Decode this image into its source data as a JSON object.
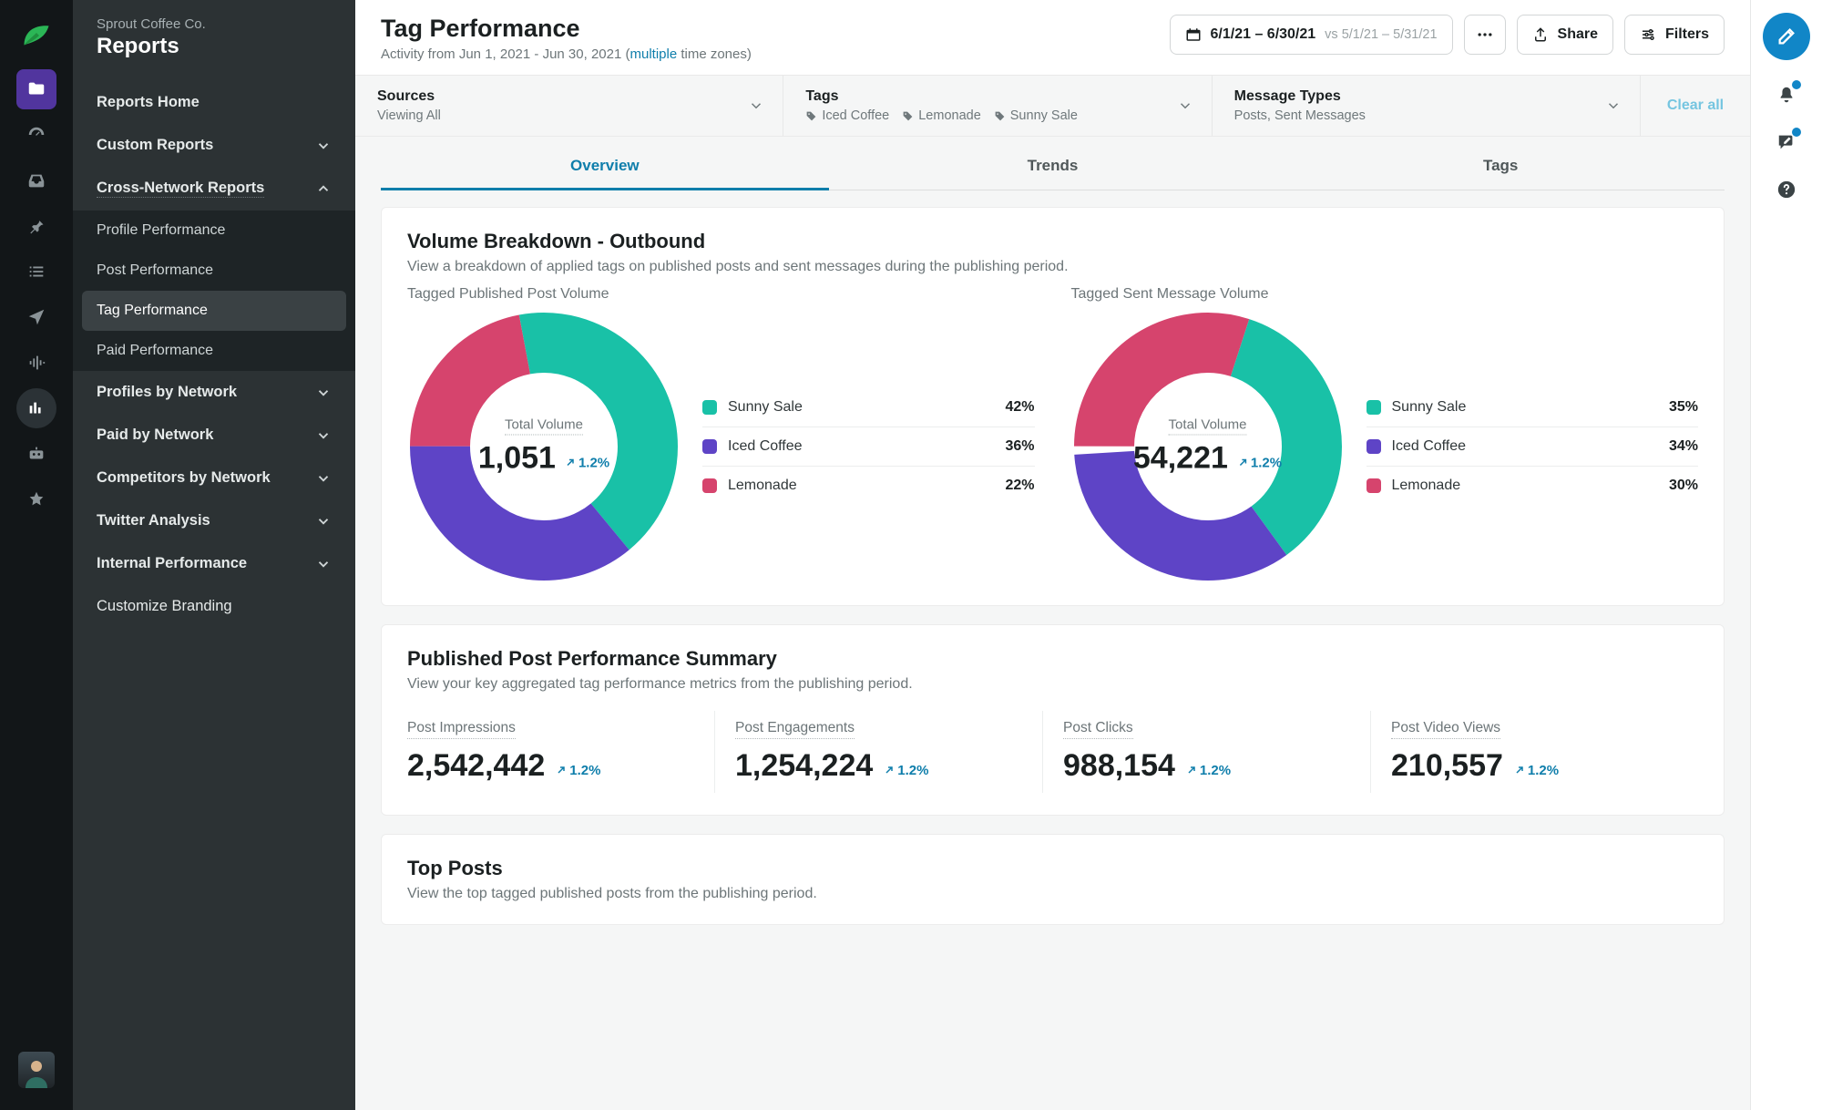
{
  "brand": {
    "company": "Sprout Coffee Co.",
    "section": "Reports"
  },
  "sidebar": {
    "reports_home": "Reports Home",
    "custom_reports": "Custom Reports",
    "cross_network": "Cross-Network Reports",
    "sub": {
      "profile_perf": "Profile Performance",
      "post_perf": "Post Performance",
      "tag_perf": "Tag Performance",
      "paid_perf": "Paid Performance"
    },
    "profiles_by_net": "Profiles by Network",
    "paid_by_net": "Paid by Network",
    "competitors_by_net": "Competitors by Network",
    "twitter_analysis": "Twitter Analysis",
    "internal_perf": "Internal Performance",
    "customize_branding": "Customize Branding"
  },
  "header": {
    "title": "Tag Performance",
    "activity_prefix": "Activity from Jun 1, 2021 - Jun 30, 2021 (",
    "multiple": "multiple",
    "activity_suffix": " time zones)",
    "date_main": "6/1/21 – 6/30/21",
    "date_vs": "vs 5/1/21 – 5/31/21",
    "share": "Share",
    "filters": "Filters"
  },
  "filters": {
    "sources_lbl": "Sources",
    "sources_val": "Viewing All",
    "tags_lbl": "Tags",
    "tag1": "Iced Coffee",
    "tag2": "Lemonade",
    "tag3": "Sunny Sale",
    "types_lbl": "Message Types",
    "types_val": "Posts, Sent Messages",
    "clear": "Clear all"
  },
  "tabs": {
    "overview": "Overview",
    "trends": "Trends",
    "tags": "Tags"
  },
  "volume": {
    "title": "Volume Breakdown - Outbound",
    "sub": "View a breakdown of applied tags on published posts and sent messages during the publishing period.",
    "post_head": "Tagged Published Post Volume",
    "msg_head": "Tagged Sent Message Volume",
    "center_lbl": "Total Volume",
    "post_total": "1,051",
    "msg_total": "54,221",
    "trend": "1.2%",
    "legend": {
      "sunny": "Sunny Sale",
      "iced": "Iced Coffee",
      "lemon": "Lemonade"
    },
    "post_pct": {
      "sunny": "42%",
      "iced": "36%",
      "lemon": "22%"
    },
    "msg_pct": {
      "sunny": "35%",
      "iced": "34%",
      "lemon": "30%"
    }
  },
  "summary": {
    "title": "Published Post Performance Summary",
    "sub": "View your key aggregated tag performance metrics from the publishing period.",
    "m1_lbl": "Post Impressions",
    "m1_val": "2,542,442",
    "m2_lbl": "Post Engagements",
    "m2_val": "1,254,224",
    "m3_lbl": "Post Clicks",
    "m3_val": "988,154",
    "m4_lbl": "Post Video Views",
    "m4_val": "210,557",
    "trend": "1.2%"
  },
  "top_posts": {
    "title": "Top Posts",
    "sub": "View the top tagged published posts from the publishing period."
  },
  "colors": {
    "teal": "#19c1a7",
    "purple": "#5e44c6",
    "pink": "#d6446d",
    "blue": "#0f7eab"
  },
  "chart_data": [
    {
      "type": "pie",
      "title": "Tagged Published Post Volume",
      "total": 1051,
      "trend_pct": 1.2,
      "series": [
        {
          "name": "Sunny Sale",
          "value": 42,
          "color": "#19c1a7"
        },
        {
          "name": "Iced Coffee",
          "value": 36,
          "color": "#5e44c6"
        },
        {
          "name": "Lemonade",
          "value": 22,
          "color": "#d6446d"
        }
      ]
    },
    {
      "type": "pie",
      "title": "Tagged Sent Message Volume",
      "total": 54221,
      "trend_pct": 1.2,
      "series": [
        {
          "name": "Sunny Sale",
          "value": 35,
          "color": "#19c1a7"
        },
        {
          "name": "Iced Coffee",
          "value": 34,
          "color": "#5e44c6"
        },
        {
          "name": "Lemonade",
          "value": 30,
          "color": "#d6446d"
        }
      ]
    }
  ]
}
